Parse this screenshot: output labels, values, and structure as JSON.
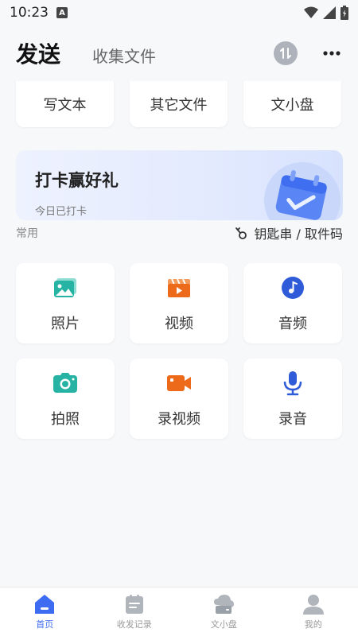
{
  "status_bar": {
    "time": "10:23",
    "a_badge": "A"
  },
  "header": {
    "active_tab": "发送",
    "tab_collect": "收集文件"
  },
  "top_row": [
    {
      "label": "写文本"
    },
    {
      "label": "其它文件"
    },
    {
      "label": "文小盘"
    }
  ],
  "banner": {
    "title": "打卡赢好礼",
    "subtitle": "今日已打卡"
  },
  "section": {
    "common_label": "常用",
    "keychain_label": "钥匙串 / 取件码"
  },
  "grid": [
    {
      "label": "照片",
      "icon": "photo-icon",
      "color": "#26b3a3"
    },
    {
      "label": "视频",
      "icon": "video-icon",
      "color": "#ec6a1a"
    },
    {
      "label": "音频",
      "icon": "audio-icon",
      "color": "#2f5bd9"
    },
    {
      "label": "拍照",
      "icon": "camera-icon",
      "color": "#26b3a3"
    },
    {
      "label": "录视频",
      "icon": "record-video-icon",
      "color": "#ec6a1a"
    },
    {
      "label": "录音",
      "icon": "microphone-icon",
      "color": "#2f5bd9"
    }
  ],
  "tabbar": [
    {
      "label": "首页",
      "icon": "home-icon",
      "active": true
    },
    {
      "label": "收发记录",
      "icon": "records-icon",
      "active": false
    },
    {
      "label": "文小盘",
      "icon": "cloud-disk-icon",
      "active": false
    },
    {
      "label": "我的",
      "icon": "profile-icon",
      "active": false
    }
  ],
  "colors": {
    "accent": "#3d6cf2",
    "inactive_icon": "#b0b4bb"
  }
}
